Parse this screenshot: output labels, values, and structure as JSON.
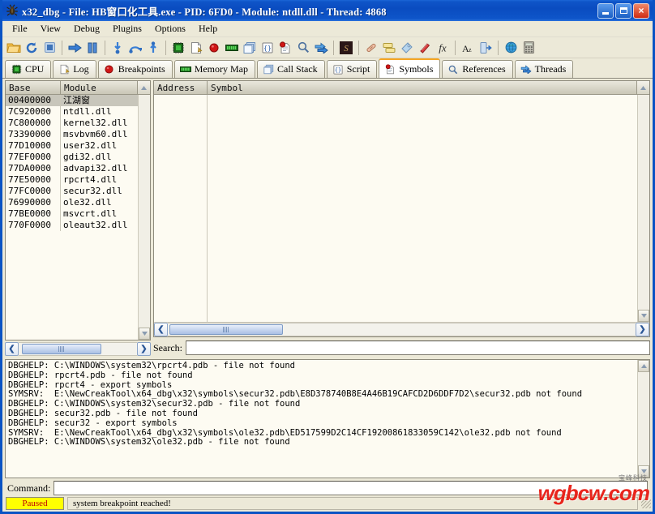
{
  "window": {
    "title": "x32_dbg - File: HB窗口化工具.exe - PID: 6FD0 - Module: ntdll.dll - Thread: 4868",
    "app_icon": "bug-icon",
    "minimize_label": "",
    "maximize_label": "",
    "close_label": "×"
  },
  "menu": {
    "items": [
      {
        "label": "File"
      },
      {
        "label": "View"
      },
      {
        "label": "Debug"
      },
      {
        "label": "Plugins"
      },
      {
        "label": "Options"
      },
      {
        "label": "Help"
      }
    ]
  },
  "toolbar": {
    "groups": [
      {
        "buttons": [
          {
            "name": "open-file-icon",
            "title": "Open"
          },
          {
            "name": "restart-icon",
            "title": "Restart"
          },
          {
            "name": "stop-icon",
            "title": "Close"
          }
        ]
      },
      {
        "buttons": [
          {
            "name": "run-icon",
            "title": "Run"
          },
          {
            "name": "pause-icon",
            "title": "Pause"
          }
        ]
      },
      {
        "buttons": [
          {
            "name": "step-into-icon",
            "title": "Step into"
          },
          {
            "name": "step-over-icon",
            "title": "Step over"
          },
          {
            "name": "step-out-icon",
            "title": "Execute till return"
          }
        ]
      },
      {
        "buttons": [
          {
            "name": "cpu-icon",
            "title": "CPU"
          },
          {
            "name": "log-icon",
            "title": "Log"
          },
          {
            "name": "breakpoints-icon",
            "title": "Breakpoints"
          },
          {
            "name": "memory-map-icon",
            "title": "Memory Map"
          },
          {
            "name": "call-stack-icon",
            "title": "Call Stack"
          },
          {
            "name": "script-icon",
            "title": "Script"
          },
          {
            "name": "symbols-icon",
            "title": "Symbols"
          },
          {
            "name": "references-icon",
            "title": "References"
          },
          {
            "name": "threads-icon",
            "title": "Threads"
          }
        ]
      },
      {
        "buttons": [
          {
            "name": "scylla-icon",
            "title": "Scylla"
          }
        ]
      },
      {
        "buttons": [
          {
            "name": "patches-icon",
            "title": "Patches"
          },
          {
            "name": "comments-icon",
            "title": "Comments"
          },
          {
            "name": "labels-icon",
            "title": "Labels"
          },
          {
            "name": "bookmarks-icon",
            "title": "Bookmarks"
          },
          {
            "name": "functions-icon",
            "title": "Functions"
          }
        ]
      },
      {
        "buttons": [
          {
            "name": "font-icon",
            "title": "Appearance"
          },
          {
            "name": "attach-icon",
            "title": "Attach"
          }
        ]
      },
      {
        "buttons": [
          {
            "name": "globe-icon",
            "title": "Donate"
          },
          {
            "name": "calculator-icon",
            "title": "Calculator"
          }
        ]
      }
    ]
  },
  "tabs": [
    {
      "label": "CPU",
      "icon": "cpu-icon",
      "active": false
    },
    {
      "label": "Log",
      "icon": "log-icon",
      "active": false
    },
    {
      "label": "Breakpoints",
      "icon": "breakpoints-icon",
      "active": false
    },
    {
      "label": "Memory Map",
      "icon": "memory-map-icon",
      "active": false
    },
    {
      "label": "Call Stack",
      "icon": "call-stack-icon",
      "active": false
    },
    {
      "label": "Script",
      "icon": "script-icon",
      "active": false
    },
    {
      "label": "Symbols",
      "icon": "symbols-icon",
      "active": true
    },
    {
      "label": "References",
      "icon": "references-icon",
      "active": false
    },
    {
      "label": "Threads",
      "icon": "threads-icon",
      "active": false
    }
  ],
  "modules": {
    "columns": [
      "Base",
      "Module"
    ],
    "rows": [
      {
        "base": "00400000",
        "module": "江湖窗",
        "selected": true
      },
      {
        "base": "7C920000",
        "module": "ntdll.dll",
        "selected": false
      },
      {
        "base": "7C800000",
        "module": "kernel32.dll",
        "selected": false
      },
      {
        "base": "73390000",
        "module": "msvbvm60.dll",
        "selected": false
      },
      {
        "base": "77D10000",
        "module": "user32.dll",
        "selected": false
      },
      {
        "base": "77EF0000",
        "module": "gdi32.dll",
        "selected": false
      },
      {
        "base": "77DA0000",
        "module": "advapi32.dll",
        "selected": false
      },
      {
        "base": "77E50000",
        "module": "rpcrt4.dll",
        "selected": false
      },
      {
        "base": "77FC0000",
        "module": "secur32.dll",
        "selected": false
      },
      {
        "base": "76990000",
        "module": "ole32.dll",
        "selected": false
      },
      {
        "base": "77BE0000",
        "module": "msvcrt.dll",
        "selected": false
      },
      {
        "base": "770F0000",
        "module": "oleaut32.dll",
        "selected": false
      }
    ]
  },
  "symbols": {
    "columns": [
      "Address",
      "Symbol"
    ],
    "rows": []
  },
  "search": {
    "label": "Search:",
    "value": "",
    "placeholder": ""
  },
  "log": {
    "text": "DBGHELP: C:\\WINDOWS\\system32\\rpcrt4.pdb - file not found\nDBGHELP: rpcrt4.pdb - file not found\nDBGHELP: rpcrt4 - export symbols\nSYMSRV:  E:\\NewCreakTool\\x64_dbg\\x32\\symbols\\secur32.pdb\\E8D378740B8E4A46B19CAFCD2D6DDF7D2\\secur32.pdb not found\nDBGHELP: C:\\WINDOWS\\system32\\secur32.pdb - file not found\nDBGHELP: secur32.pdb - file not found\nDBGHELP: secur32 - export symbols\nSYMSRV:  E:\\NewCreakTool\\x64_dbg\\x32\\symbols\\ole32.pdb\\ED517599D2C14CF19200861833059C142\\ole32.pdb not found\nDBGHELP: C:\\WINDOWS\\system32\\ole32.pdb - file not found"
  },
  "command": {
    "label": "Command:",
    "value": "",
    "placeholder": ""
  },
  "status": {
    "state": "Paused",
    "message": "system breakpoint reached!"
  },
  "watermark": {
    "main": "wgbcw.com",
    "sub": "宝峰科技"
  },
  "colors": {
    "title_bar": "#0b4cc0",
    "face": "#ece9d8",
    "list_bg": "#fdfbf2",
    "active_tab_accent": "#f5a623",
    "paused_bg": "#ffff00",
    "paused_fg": "#c00000",
    "watermark": "#e8251c"
  }
}
